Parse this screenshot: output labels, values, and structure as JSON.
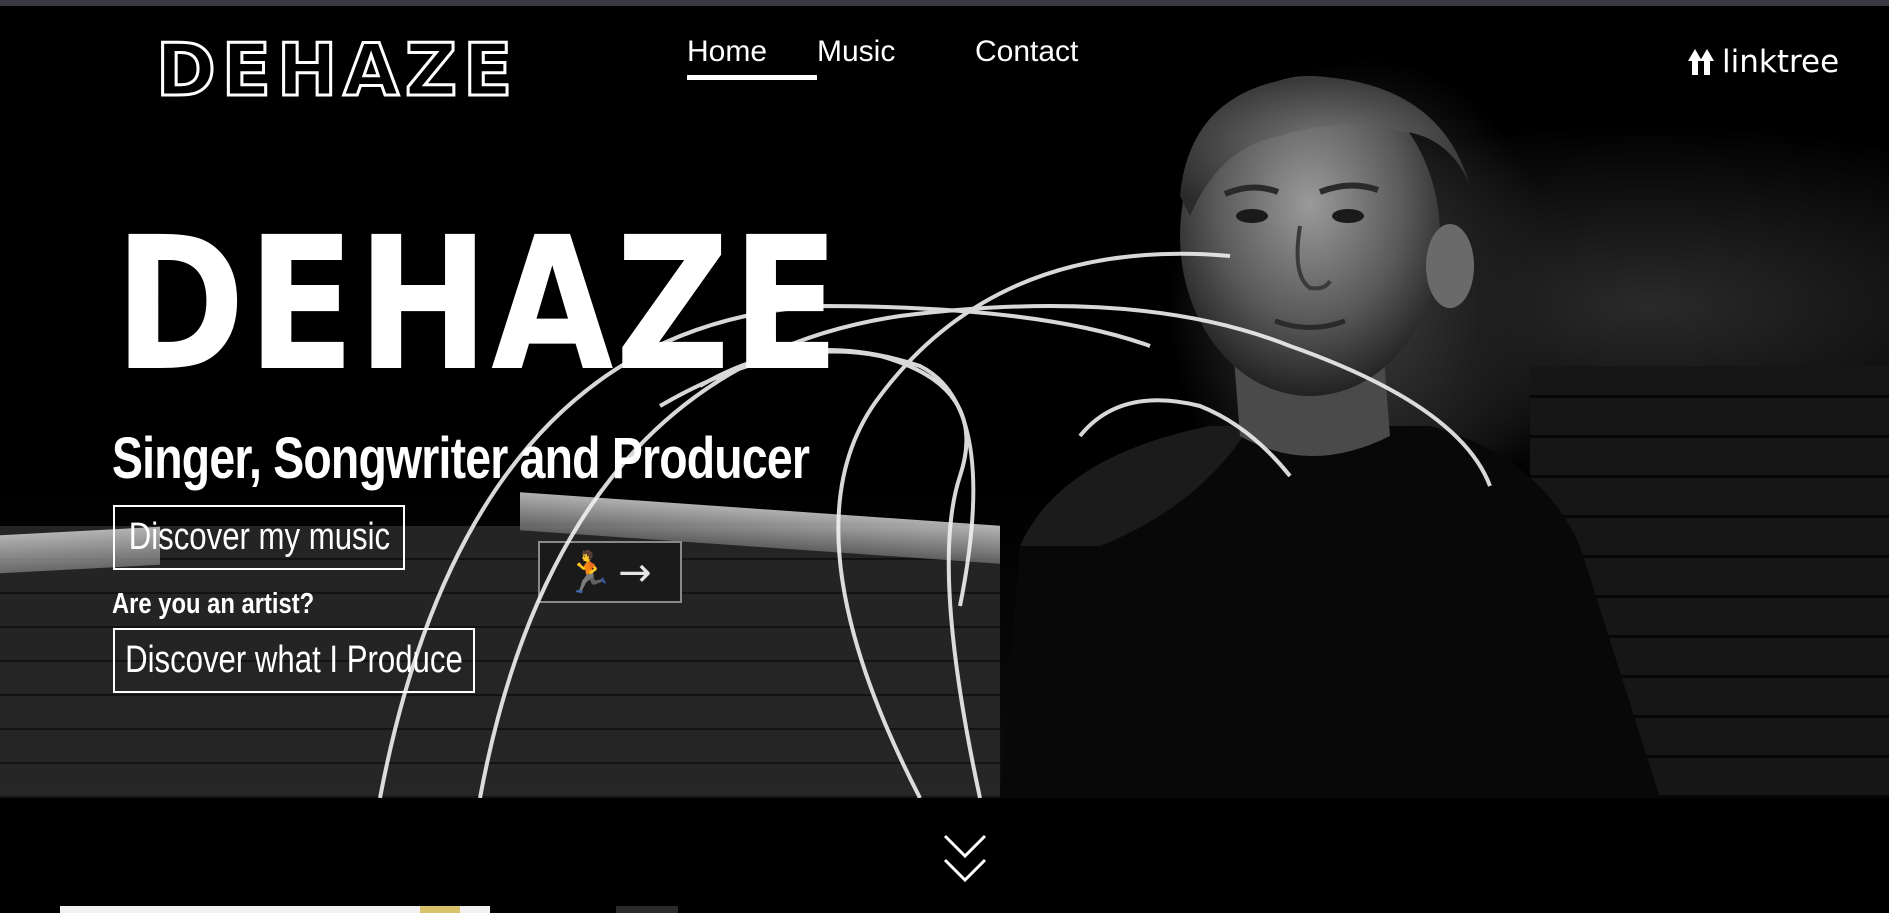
{
  "header": {
    "logo_text": "DEHAZE",
    "nav": [
      {
        "label": "Home",
        "active": true
      },
      {
        "label": "Music",
        "active": false
      },
      {
        "label": "Contact",
        "active": false
      }
    ],
    "linktree_label": "linktree",
    "linktree_icon": "linktree-icon"
  },
  "hero": {
    "title": "DEHAZE",
    "subtitle": "Singer, Songwriter and Producer",
    "primary_button": "Discover my music",
    "artist_question": "Are you an artist?",
    "secondary_button": "Discover what I Produce",
    "exit_sign_glyphs": "🏃→",
    "scroll_icon": "double-chevron-down-icon"
  },
  "colors": {
    "background": "#000000",
    "text": "#ffffff",
    "top_strip": "#3a3a42"
  }
}
